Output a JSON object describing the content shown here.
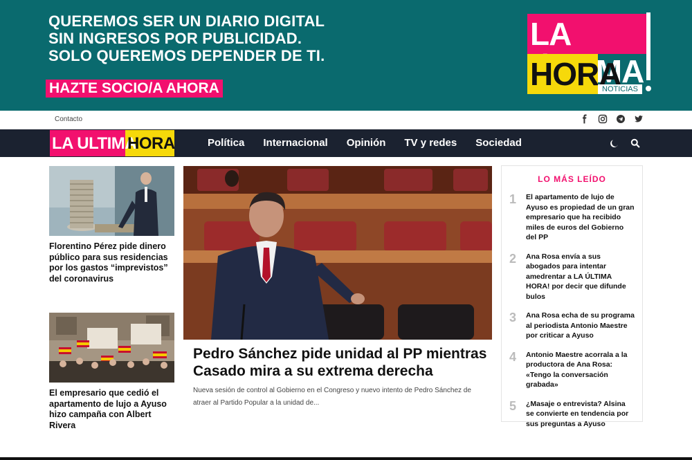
{
  "banner": {
    "lines": [
      "QUEREMOS SER UN DIARIO DIGITAL",
      "SIN INGRESOS POR PUBLICIDAD.",
      "SOLO QUEREMOS DEPENDER DE TI."
    ],
    "cta": "HAZTE SOCIO/A AHORA",
    "logo": {
      "top": "LA ÚLTIMA",
      "bottom": "HORA",
      "tag": "NOTICIAS"
    },
    "colors": {
      "background": "#0a6a6e",
      "pink": "#f2106e",
      "yellow": "#f6d90a"
    }
  },
  "utility": {
    "contact": "Contacto",
    "social": [
      "facebook-icon",
      "instagram-icon",
      "telegram-icon",
      "twitter-icon"
    ]
  },
  "nav": {
    "logo": {
      "part1": "LA ULTIMA",
      "part2": "HORA"
    },
    "items": [
      "Política",
      "Internacional",
      "Opinión",
      "TV y redes",
      "Sociedad"
    ],
    "icons": [
      "moon-icon",
      "search-icon"
    ],
    "background": "#1b2230"
  },
  "left": [
    {
      "title": "Florentino Pérez pide dinero público para sus residencias por los gastos “imprevistos” del coronavirus"
    },
    {
      "title": "El empresario que cedió el apartamento de lujo a Ayuso hizo campaña con Albert Rivera"
    }
  ],
  "lead": {
    "title": "Pedro Sánchez pide unidad al PP mientras Casado mira a su extrema derecha",
    "summary": "Nueva sesión de control al Gobierno en el Congreso y nuevo intento de Pedro Sánchez de atraer al Partido Popular a la unidad de..."
  },
  "popular": {
    "title": "LO MÁS LEÍDO",
    "items": [
      {
        "num": "1",
        "text": "El apartamento de lujo de Ayuso es propiedad de un gran empresario que ha recibido miles de euros del Gobierno del PP"
      },
      {
        "num": "2",
        "text": "Ana Rosa envía a sus abogados para intentar amedrentar a LA ÚLTIMA HORA! por decir que difunde bulos"
      },
      {
        "num": "3",
        "text": "Ana Rosa echa de su programa al periodista Antonio Maestre por criticar a Ayuso"
      },
      {
        "num": "4",
        "text": "Antonio Maestre acorrala a la productora de Ana Rosa: «Tengo la conversación grabada»"
      },
      {
        "num": "5",
        "text": "¿Masaje o entrevista? Alsina se convierte en tendencia por sus preguntas a Ayuso"
      }
    ]
  }
}
